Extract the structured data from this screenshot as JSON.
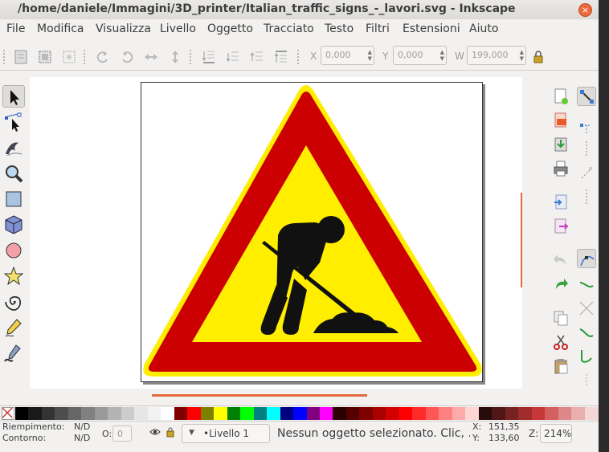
{
  "window": {
    "title": "/home/daniele/Immagini/3D_printer/Italian_traffic_signs_-_lavori.svg - Inkscape",
    "close_glyph": "×"
  },
  "menu": [
    "File",
    "Modifica",
    "Visualizza",
    "Livello",
    "Oggetto",
    "Tracciato",
    "Testo",
    "Filtri",
    "Estensioni",
    "Aiuto"
  ],
  "toolbar": {
    "x_label": "X",
    "x_value": "0,000",
    "y_label": "Y",
    "y_value": "0,000",
    "w_label": "W",
    "w_value": "199,000"
  },
  "tools": [
    "selector-tool",
    "node-tool",
    "tweak-tool",
    "zoom-tool",
    "rectangle-tool",
    "box3d-tool",
    "ellipse-tool",
    "star-tool",
    "spiral-tool",
    "pencil-tool",
    "calligraphy-tool"
  ],
  "palette": {
    "colors": [
      "#000000",
      "#1a1a1a",
      "#333333",
      "#4d4d4d",
      "#666666",
      "#808080",
      "#999999",
      "#b3b3b3",
      "#cccccc",
      "#e6e6e6",
      "#f2f2f2",
      "#ffffff",
      "#800000",
      "#ff0000",
      "#808000",
      "#ffff00",
      "#008000",
      "#00ff00",
      "#008080",
      "#00ffff",
      "#000080",
      "#0000ff",
      "#800080",
      "#ff00ff",
      "#2b0000",
      "#550000",
      "#800000",
      "#aa0000",
      "#d40000",
      "#ff0000",
      "#ff2a2a",
      "#ff5555",
      "#ff8080",
      "#ffaaaa",
      "#ffd5d5",
      "#280b0b",
      "#501616",
      "#782121",
      "#a02c2c",
      "#c83737",
      "#d35f5f",
      "#de8787",
      "#e9afaf",
      "#f4d7d7"
    ]
  },
  "status": {
    "fill_label": "Riempimento:",
    "fill_value": "N/D",
    "stroke_label": "Contorno:",
    "stroke_value": "N/D",
    "opacity_label": "O:",
    "opacity_value": "0",
    "layer": "•Livello 1",
    "message": "Nessun oggetto selezionato. Clic, …",
    "x_label": "X:",
    "x_value": "151,35",
    "y_label": "Y:",
    "y_value": "133,60",
    "zoom_label": "Z:",
    "zoom_value": "214%"
  },
  "colors": {
    "sign_red": "#cc0000",
    "sign_yellow": "#ffee00",
    "accent_scroll": "#e36a3c",
    "close_button": "#ee6a3e"
  }
}
